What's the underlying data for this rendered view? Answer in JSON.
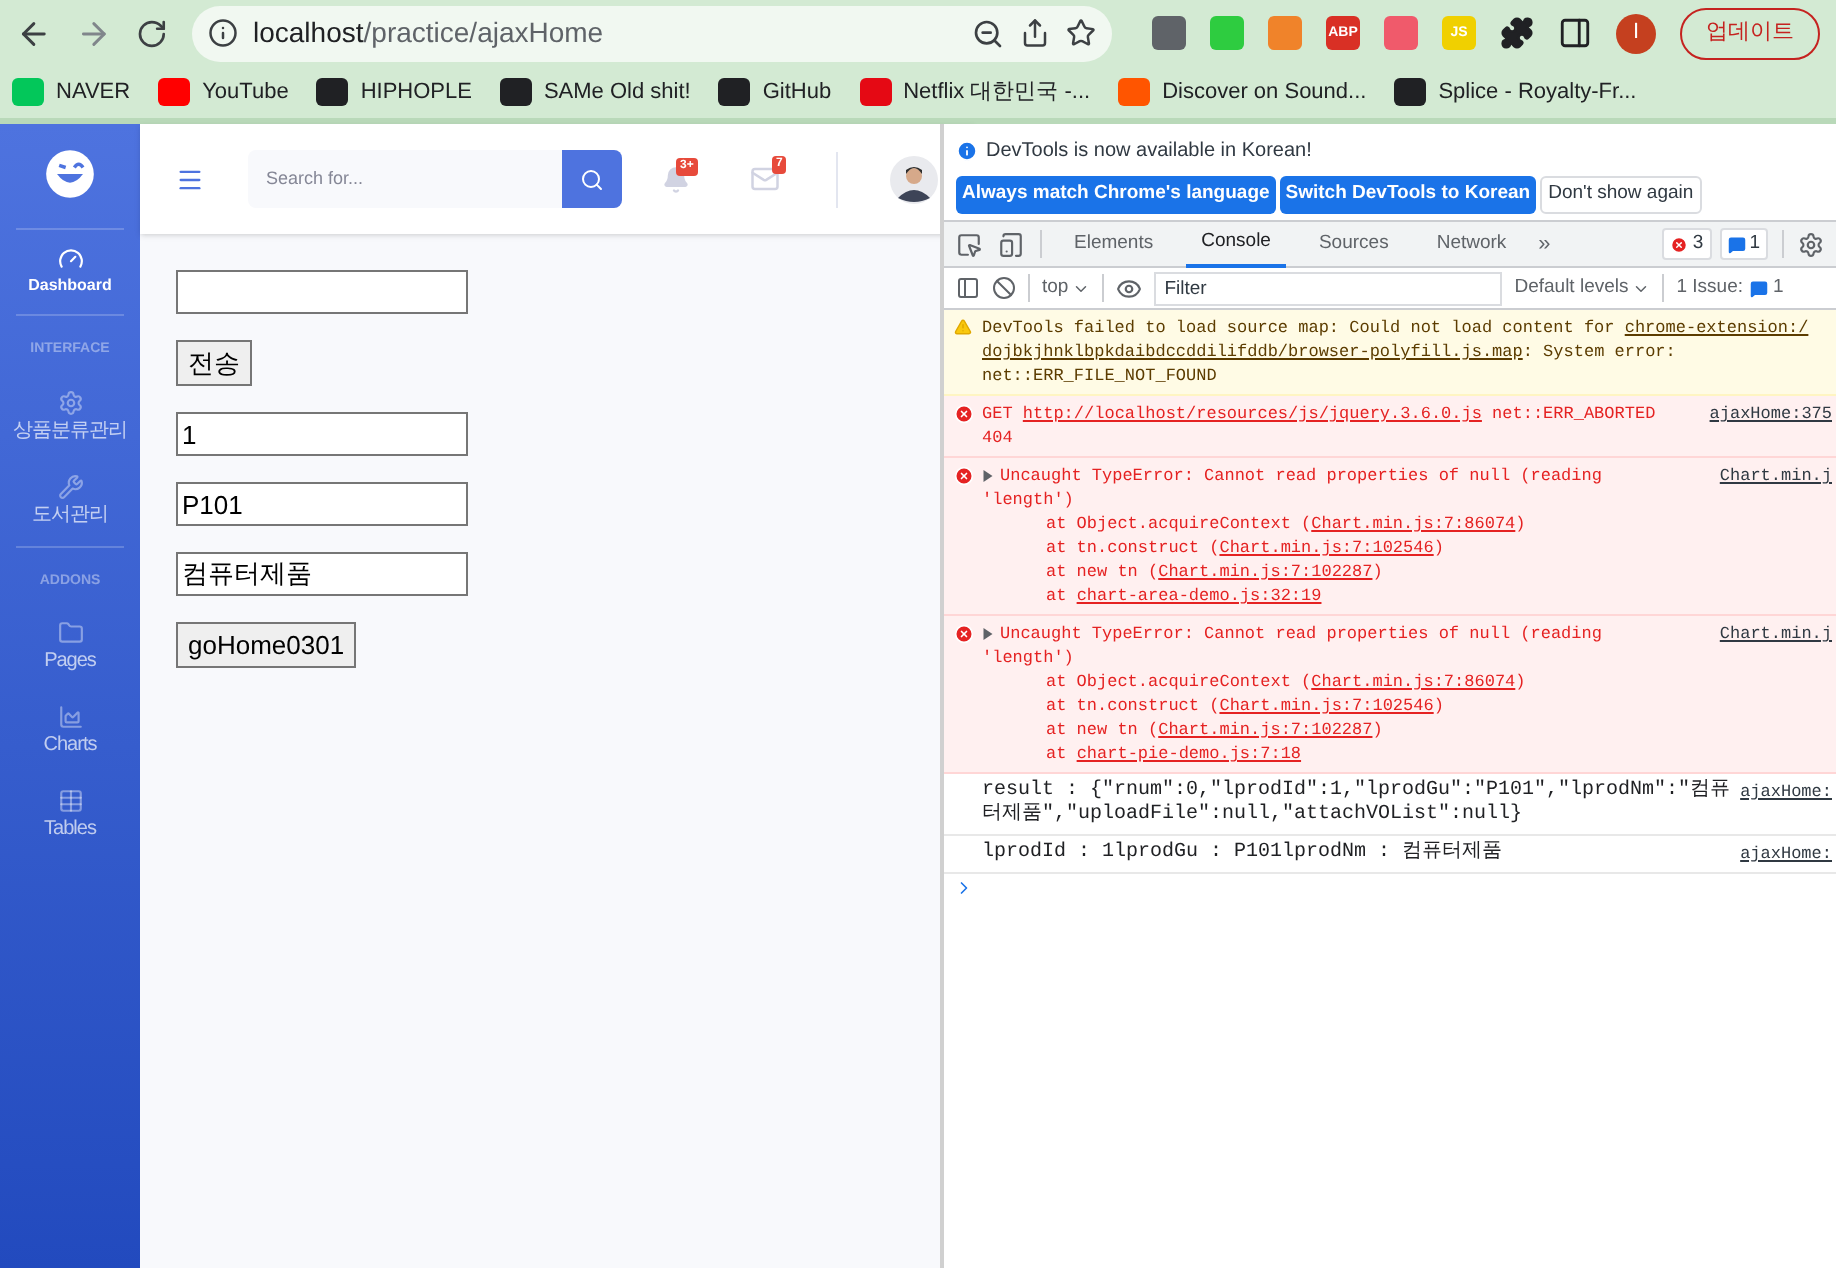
{
  "browser": {
    "url_host": "localhost",
    "url_path": "/practice/ajaxHome",
    "extensions": [
      {
        "color": "#5f6368"
      },
      {
        "color": "#2ecc40"
      },
      {
        "color": "#f0832a"
      },
      {
        "color": "#d93025",
        "label": "ABP"
      },
      {
        "color": "#f05a6b"
      },
      {
        "color": "#f0d000",
        "label": "JS"
      }
    ],
    "profile": "I",
    "update_button": "업데이트"
  },
  "bookmarks": [
    {
      "label": "NAVER",
      "color": "#03c75a"
    },
    {
      "label": "YouTube",
      "color": "#ff0000"
    },
    {
      "label": "HIPHOPLE",
      "color": "#202124"
    },
    {
      "label": "SAMe Old shit!",
      "color": "#202124"
    },
    {
      "label": "GitHub",
      "color": "#202124"
    },
    {
      "label": "Netflix 대한민국 -...",
      "color": "#e50914"
    },
    {
      "label": "Discover on Sound...",
      "color": "#ff5500"
    },
    {
      "label": "Splice - Royalty-Fr...",
      "color": "#202124"
    }
  ],
  "sidebar": {
    "items": [
      {
        "kind": "item",
        "label": "Dashboard",
        "selected": true
      },
      {
        "kind": "heading",
        "label": "INTERFACE"
      },
      {
        "kind": "item",
        "label": "상품분류관리",
        "selected": false
      },
      {
        "kind": "item",
        "label": "도서관리",
        "selected": false
      },
      {
        "kind": "heading",
        "label": "ADDONS"
      },
      {
        "kind": "item",
        "label": "Pages",
        "selected": false
      },
      {
        "kind": "item",
        "label": "Charts",
        "selected": false
      },
      {
        "kind": "item",
        "label": "Tables",
        "selected": false
      }
    ]
  },
  "topbar": {
    "search_placeholder": "Search for...",
    "alerts_badge": "3+",
    "messages_badge": "7"
  },
  "form": [
    {
      "kind": "input"
    },
    {
      "kind": "button",
      "label": "전송"
    },
    {
      "kind": "input",
      "value": "1"
    },
    {
      "kind": "input",
      "value": "P101"
    },
    {
      "kind": "input",
      "value": "컴퓨터제품"
    },
    {
      "kind": "button",
      "label": "goHome0301"
    }
  ],
  "devtools": {
    "notice": "DevTools is now available in Korean!",
    "notice_buttons": [
      {
        "label": "Always match Chrome's language",
        "primary": true
      },
      {
        "label": "Switch DevTools to Korean",
        "primary": true
      },
      {
        "label": "Don't show again",
        "primary": false
      }
    ],
    "tabs": [
      {
        "label": "Elements",
        "selected": false
      },
      {
        "label": "Console",
        "selected": true
      },
      {
        "label": "Sources",
        "selected": false
      },
      {
        "label": "Network",
        "selected": false
      }
    ],
    "more_tabs": "»",
    "error_count": "3",
    "message_count": "1",
    "context": "top",
    "filter_placeholder": "Filter",
    "levels": "Default levels",
    "issues_label": "1 Issue:",
    "issues_count": "1",
    "messages": [
      {
        "kind": "warning",
        "lines": [
          [
            {
              "kind": "text",
              "text": "DevTools failed to load source map: Could not load content for "
            },
            {
              "kind": "link",
              "text": "chrome-extension:/"
            }
          ],
          [
            {
              "kind": "link",
              "text": "dojbkjhnklbpkdaibdccddilifddb/browser-polyfill.js.map"
            },
            {
              "kind": "text",
              "text": ": System error:"
            }
          ],
          [
            {
              "kind": "text",
              "text": "net::ERR_FILE_NOT_FOUND"
            }
          ]
        ]
      },
      {
        "kind": "error",
        "source": "ajaxHome:375",
        "lines": [
          [
            {
              "kind": "text",
              "text": "GET "
            },
            {
              "kind": "link",
              "text": "http://localhost/resources/js/jquery.3.6.0.js"
            },
            {
              "kind": "text",
              "text": " net::ERR_ABORTED"
            }
          ],
          [
            {
              "kind": "text",
              "text": "404"
            }
          ]
        ]
      },
      {
        "kind": "error",
        "expanded": false,
        "source": "Chart.min.j",
        "lines": [
          [
            {
              "kind": "text",
              "text": "Uncaught TypeError: Cannot read properties of null (reading"
            }
          ],
          [
            {
              "kind": "text",
              "text": "'length')"
            }
          ]
        ],
        "stack": [
          [
            {
              "kind": "text",
              "text": "at Object.acquireContext ("
            },
            {
              "kind": "link",
              "text": "Chart.min.js:7:86074"
            },
            {
              "kind": "text",
              "text": ")"
            }
          ],
          [
            {
              "kind": "text",
              "text": "at tn.construct ("
            },
            {
              "kind": "link",
              "text": "Chart.min.js:7:102546"
            },
            {
              "kind": "text",
              "text": ")"
            }
          ],
          [
            {
              "kind": "text",
              "text": "at new tn ("
            },
            {
              "kind": "link",
              "text": "Chart.min.js:7:102287"
            },
            {
              "kind": "text",
              "text": ")"
            }
          ],
          [
            {
              "kind": "text",
              "text": "at "
            },
            {
              "kind": "link",
              "text": "chart-area-demo.js:32:19"
            }
          ]
        ]
      },
      {
        "kind": "error",
        "expanded": false,
        "source": "Chart.min.j",
        "lines": [
          [
            {
              "kind": "text",
              "text": "Uncaught TypeError: Cannot read properties of null (reading"
            }
          ],
          [
            {
              "kind": "text",
              "text": "'length')"
            }
          ]
        ],
        "stack": [
          [
            {
              "kind": "text",
              "text": "at Object.acquireContext ("
            },
            {
              "kind": "link",
              "text": "Chart.min.js:7:86074"
            },
            {
              "kind": "text",
              "text": ")"
            }
          ],
          [
            {
              "kind": "text",
              "text": "at tn.construct ("
            },
            {
              "kind": "link",
              "text": "Chart.min.js:7:102546"
            },
            {
              "kind": "text",
              "text": ")"
            }
          ],
          [
            {
              "kind": "text",
              "text": "at new tn ("
            },
            {
              "kind": "link",
              "text": "Chart.min.js:7:102287"
            },
            {
              "kind": "text",
              "text": ")"
            }
          ],
          [
            {
              "kind": "text",
              "text": "at "
            },
            {
              "kind": "link",
              "text": "chart-pie-demo.js:7:18"
            }
          ]
        ]
      },
      {
        "kind": "log",
        "source": "ajaxHome:",
        "text": "result : {\"rnum\":0,\"lprodId\":1,\"lprodGu\":\"P101\",\"lprodNm\":\"컴퓨터제품\",\"uploadFile\":null,\"attachVOList\":null}"
      },
      {
        "kind": "log",
        "source": "ajaxHome:",
        "text": "lprodId : 1lprodGu : P101lprodNm : 컴퓨터제품"
      }
    ]
  }
}
